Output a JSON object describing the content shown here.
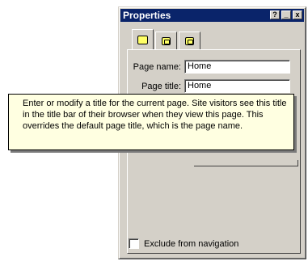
{
  "window": {
    "title": "Properties",
    "buttons": [
      "?",
      "_",
      "x"
    ]
  },
  "tabs": [
    {
      "icon": "page-icon"
    },
    {
      "icon": "page-check-icon"
    },
    {
      "icon": "page-link-icon"
    }
  ],
  "page_name": {
    "label": "Page name:",
    "value": "Home"
  },
  "page_title": {
    "label": "Page title:",
    "value": "Home"
  },
  "exclude": {
    "label": "Exclude from navigation",
    "checked": false
  },
  "tooltip": {
    "text": "Enter or modify a title for the current page. Site visitors see this title in the title bar of their browser when they view this page. This overrides the default page title, which is the page name."
  }
}
